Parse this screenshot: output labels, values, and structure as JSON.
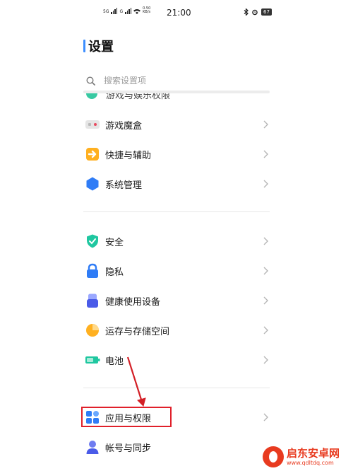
{
  "status_bar": {
    "signal1": "5G",
    "signal2": "G",
    "net_speed": "0.50 KB/s",
    "time": "21:00",
    "battery": "67"
  },
  "page": {
    "title": "设置"
  },
  "search": {
    "placeholder": "搜索设置项"
  },
  "partial_item": {
    "label": "游戏与娱乐权限"
  },
  "groups": [
    [
      {
        "label": "游戏魔盒",
        "icon": "game-box-icon"
      },
      {
        "label": "快捷与辅助",
        "icon": "shortcut-icon"
      },
      {
        "label": "系统管理",
        "icon": "system-management-icon"
      }
    ],
    [
      {
        "label": "安全",
        "icon": "security-shield-icon"
      },
      {
        "label": "隐私",
        "icon": "privacy-lock-icon"
      },
      {
        "label": "健康使用设备",
        "icon": "health-usage-icon"
      },
      {
        "label": "运存与存储空间",
        "icon": "storage-pie-icon"
      },
      {
        "label": "电池",
        "icon": "battery-icon"
      }
    ],
    [
      {
        "label": "应用与权限",
        "icon": "apps-permissions-icon"
      },
      {
        "label": "帐号与同步",
        "icon": "account-sync-icon"
      }
    ]
  ],
  "colors": {
    "accent": "#3d8eff",
    "highlight": "#e0202a",
    "watermark": "#e83a1f"
  },
  "watermark": {
    "name": "启东安卓网",
    "url": "www.qdltdq.com"
  }
}
